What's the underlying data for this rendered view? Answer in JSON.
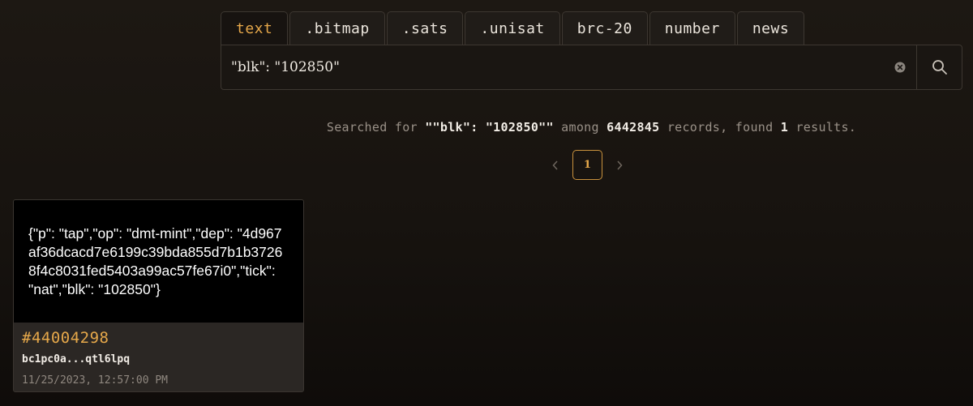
{
  "tabs": [
    {
      "label": "text",
      "active": true
    },
    {
      "label": ".bitmap",
      "active": false
    },
    {
      "label": ".sats",
      "active": false
    },
    {
      "label": ".unisat",
      "active": false
    },
    {
      "label": "brc-20",
      "active": false
    },
    {
      "label": "number",
      "active": false
    },
    {
      "label": "news",
      "active": false
    }
  ],
  "search": {
    "value": "\"blk\": \"102850\"",
    "clear_icon": "clear-circle-icon",
    "search_icon": "search-icon"
  },
  "summary": {
    "prefix": "Searched for ",
    "query": "\"\"blk\": \"102850\"\"",
    "among": " among ",
    "records": "6442845",
    "records_suffix": " records, found ",
    "found": "1",
    "found_suffix": " results."
  },
  "pagination": {
    "current_page": "1",
    "prev_icon": "chevron-left-icon",
    "next_icon": "chevron-right-icon"
  },
  "results": [
    {
      "content": "{\"p\": \"tap\",\"op\": \"dmt-mint\",\"dep\": \"4d967af36dcacd7e6199c39bda855d7b1b37268f4c8031fed5403a99ac57fe67i0\",\"tick\": \"nat\",\"blk\": \"102850\"}",
      "number": "#44004298",
      "address": "bc1pc0a...qtl6lpq",
      "timestamp": "11/25/2023, 12:57:00 PM"
    }
  ],
  "colors": {
    "accent": "#e6a84a",
    "background": "#1d1813",
    "border": "#3d3731"
  }
}
